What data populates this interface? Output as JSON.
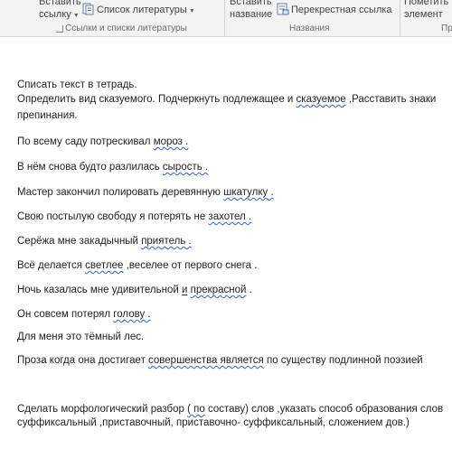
{
  "ribbon": {
    "insert_citation_line1": "Вставить",
    "insert_citation_line2": "ссылку",
    "bibliography_label": "Список литературы",
    "group_citations": "Ссылки и списки литературы",
    "insert_caption_line1": "Вставить",
    "insert_caption_line2": "название",
    "cross_reference_label": "Перекрестная ссылка",
    "group_captions": "Названия",
    "mark_entry_line1": "Пометить",
    "mark_entry_line2": "элемент",
    "group_index_partial": "Пр"
  },
  "doc": {
    "l1": "Списать текст в тетрадь.",
    "l2a": "Определить вид сказуемого. Подчеркнуть подлежащее и ",
    "l2b": "сказуемое",
    "l2c": " ,Расставить знаки",
    "l3": "препинания.",
    "s1a": "По всему саду потрескивал ",
    "s1b": "мороз .",
    "s2a": "В   нём снова будто разлилась ",
    "s2b": "сырость .",
    "s3a": "Мастер закончил полировать деревянную ",
    "s3b": "шкатулку .",
    "s4a": "Свою постылую свободу   я потерять не ",
    "s4b": "захотел .",
    "s5a": "Серёжа мне закадычный ",
    "s5b": "приятель .",
    "s6a": "Всё делается ",
    "s6b": "светлее",
    "s6c": "  ,веселее от первого снега .",
    "s7a": "Ночь казалась мне удивительной ",
    "s7b": "и",
    "s7c": " ",
    "s7d": "прекрасной",
    "s7e": " .",
    "s8a": "Он совсем потерял ",
    "s8b": "голову .",
    "s9": "Для меня это тёмный лес.",
    "s10a": "Проза когда она достигает ",
    "s10b": "совершенства  является",
    "s10c": "  по  существу  подлинной    поэзией",
    "t1a": "Сделать морфологический разбор ",
    "t1b": "( по",
    "t1c": " составу)  слов ,указать способ образования слов",
    "t2": "суффиксальный ,приставочный, приставочно- суффиксальный, сложением дов.)"
  }
}
